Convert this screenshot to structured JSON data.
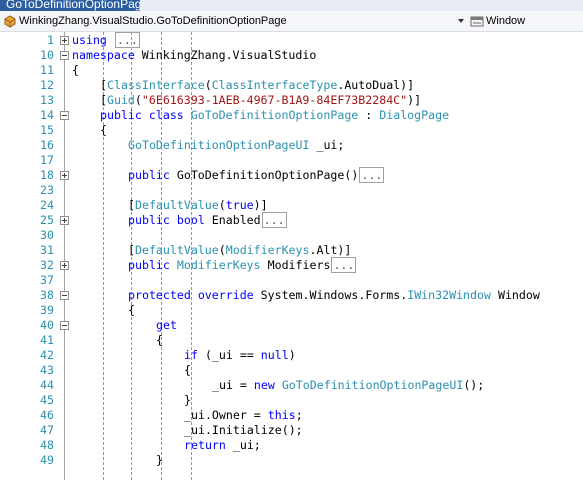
{
  "tab": {
    "title": "GoToDefinitionOptionPage.cs"
  },
  "navbar": {
    "type_selector": "WinkingZhang.VisualStudio.GoToDefinitionOptionPage",
    "member_selector": "Window"
  },
  "colors": {
    "keyword": "#0000ff",
    "type": "#2b91af",
    "string": "#a31515",
    "line_number": "#2b91af"
  },
  "lines": [
    {
      "num": "1",
      "fold": "closed",
      "indent": 0,
      "tokens": [
        {
          "t": "kw",
          "v": "using"
        },
        {
          "t": "tx",
          "v": " "
        },
        {
          "t": "coll"
        }
      ]
    },
    {
      "num": "10",
      "fold": "open",
      "indent": 0,
      "tokens": [
        {
          "t": "kw",
          "v": "namespace"
        },
        {
          "t": "tx",
          "v": " WinkingZhang.VisualStudio"
        }
      ]
    },
    {
      "num": "11",
      "fold": "",
      "indent": 0,
      "tokens": [
        {
          "t": "tx",
          "v": "{"
        }
      ]
    },
    {
      "num": "12",
      "fold": "",
      "indent": 4,
      "tokens": [
        {
          "t": "tx",
          "v": "["
        },
        {
          "t": "ty",
          "v": "ClassInterface"
        },
        {
          "t": "tx",
          "v": "("
        },
        {
          "t": "ty",
          "v": "ClassInterfaceType"
        },
        {
          "t": "tx",
          "v": ".AutoDual)]"
        }
      ]
    },
    {
      "num": "13",
      "fold": "",
      "indent": 4,
      "tokens": [
        {
          "t": "tx",
          "v": "["
        },
        {
          "t": "ty",
          "v": "Guid"
        },
        {
          "t": "tx",
          "v": "("
        },
        {
          "t": "st",
          "v": "\"6E616393-1AEB-4967-B1A9-84EF73B2284C\""
        },
        {
          "t": "tx",
          "v": ")]"
        }
      ]
    },
    {
      "num": "14",
      "fold": "open",
      "indent": 4,
      "tokens": [
        {
          "t": "kw",
          "v": "public"
        },
        {
          "t": "tx",
          "v": " "
        },
        {
          "t": "kw",
          "v": "class"
        },
        {
          "t": "tx",
          "v": " "
        },
        {
          "t": "ty",
          "v": "GoToDefinitionOptionPage"
        },
        {
          "t": "tx",
          "v": " : "
        },
        {
          "t": "ty",
          "v": "DialogPage"
        }
      ]
    },
    {
      "num": "15",
      "fold": "",
      "indent": 4,
      "tokens": [
        {
          "t": "tx",
          "v": "{"
        }
      ]
    },
    {
      "num": "16",
      "fold": "",
      "indent": 8,
      "tokens": [
        {
          "t": "ty",
          "v": "GoToDefinitionOptionPageUI"
        },
        {
          "t": "tx",
          "v": " _ui;"
        }
      ]
    },
    {
      "num": "17",
      "fold": "",
      "indent": 0,
      "tokens": []
    },
    {
      "num": "18",
      "fold": "closed",
      "indent": 8,
      "tokens": [
        {
          "t": "kw",
          "v": "public"
        },
        {
          "t": "tx",
          "v": " GoToDefinitionOptionPage()"
        },
        {
          "t": "coll"
        }
      ]
    },
    {
      "num": "23",
      "fold": "",
      "indent": 0,
      "tokens": []
    },
    {
      "num": "24",
      "fold": "",
      "indent": 8,
      "tokens": [
        {
          "t": "tx",
          "v": "["
        },
        {
          "t": "ty",
          "v": "DefaultValue"
        },
        {
          "t": "tx",
          "v": "("
        },
        {
          "t": "kw",
          "v": "true"
        },
        {
          "t": "tx",
          "v": ")]"
        }
      ]
    },
    {
      "num": "25",
      "fold": "closed",
      "indent": 8,
      "tokens": [
        {
          "t": "kw",
          "v": "public"
        },
        {
          "t": "tx",
          "v": " "
        },
        {
          "t": "kw",
          "v": "bool"
        },
        {
          "t": "tx",
          "v": " Enabled"
        },
        {
          "t": "coll"
        }
      ]
    },
    {
      "num": "30",
      "fold": "",
      "indent": 0,
      "tokens": []
    },
    {
      "num": "31",
      "fold": "",
      "indent": 8,
      "tokens": [
        {
          "t": "tx",
          "v": "["
        },
        {
          "t": "ty",
          "v": "DefaultValue"
        },
        {
          "t": "tx",
          "v": "("
        },
        {
          "t": "ty",
          "v": "ModifierKeys"
        },
        {
          "t": "tx",
          "v": ".Alt)]"
        }
      ]
    },
    {
      "num": "32",
      "fold": "closed",
      "indent": 8,
      "tokens": [
        {
          "t": "kw",
          "v": "public"
        },
        {
          "t": "tx",
          "v": " "
        },
        {
          "t": "ty",
          "v": "ModifierKeys"
        },
        {
          "t": "tx",
          "v": " Modifiers"
        },
        {
          "t": "coll"
        }
      ]
    },
    {
      "num": "37",
      "fold": "",
      "indent": 0,
      "tokens": []
    },
    {
      "num": "38",
      "fold": "open",
      "indent": 8,
      "tokens": [
        {
          "t": "kw",
          "v": "protected"
        },
        {
          "t": "tx",
          "v": " "
        },
        {
          "t": "kw",
          "v": "override"
        },
        {
          "t": "tx",
          "v": " System.Windows.Forms."
        },
        {
          "t": "ty",
          "v": "IWin32Window"
        },
        {
          "t": "tx",
          "v": " Window"
        }
      ]
    },
    {
      "num": "39",
      "fold": "",
      "indent": 8,
      "tokens": [
        {
          "t": "tx",
          "v": "{"
        }
      ]
    },
    {
      "num": "40",
      "fold": "open",
      "indent": 12,
      "tokens": [
        {
          "t": "kw",
          "v": "get"
        }
      ]
    },
    {
      "num": "41",
      "fold": "",
      "indent": 12,
      "tokens": [
        {
          "t": "tx",
          "v": "{"
        }
      ]
    },
    {
      "num": "42",
      "fold": "",
      "indent": 16,
      "tokens": [
        {
          "t": "kw",
          "v": "if"
        },
        {
          "t": "tx",
          "v": " (_ui == "
        },
        {
          "t": "kw",
          "v": "null"
        },
        {
          "t": "tx",
          "v": ")"
        }
      ]
    },
    {
      "num": "43",
      "fold": "",
      "indent": 16,
      "tokens": [
        {
          "t": "tx",
          "v": "{"
        }
      ]
    },
    {
      "num": "44",
      "fold": "",
      "indent": 20,
      "tokens": [
        {
          "t": "tx",
          "v": "_ui = "
        },
        {
          "t": "kw",
          "v": "new"
        },
        {
          "t": "tx",
          "v": " "
        },
        {
          "t": "ty",
          "v": "GoToDefinitionOptionPageUI"
        },
        {
          "t": "tx",
          "v": "();"
        }
      ]
    },
    {
      "num": "45",
      "fold": "",
      "indent": 16,
      "tokens": [
        {
          "t": "tx",
          "v": "}"
        }
      ]
    },
    {
      "num": "46",
      "fold": "",
      "indent": 16,
      "tokens": [
        {
          "t": "tx",
          "v": "_ui.Owner = "
        },
        {
          "t": "kw",
          "v": "this"
        },
        {
          "t": "tx",
          "v": ";"
        }
      ]
    },
    {
      "num": "47",
      "fold": "",
      "indent": 16,
      "tokens": [
        {
          "t": "tx",
          "v": "_ui.Initialize();"
        }
      ]
    },
    {
      "num": "48",
      "fold": "",
      "indent": 16,
      "tokens": [
        {
          "t": "kw",
          "v": "return"
        },
        {
          "t": "tx",
          "v": " _ui;"
        }
      ]
    },
    {
      "num": "49",
      "fold": "",
      "indent": 12,
      "tokens": [
        {
          "t": "tx",
          "v": "}"
        }
      ]
    }
  ]
}
